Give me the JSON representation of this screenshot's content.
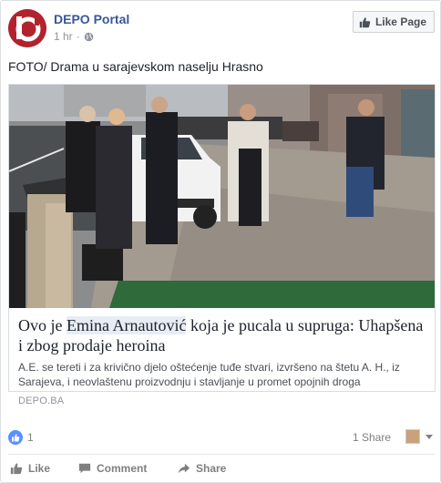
{
  "post": {
    "page_name": "DEPO Portal",
    "time": "1 hr",
    "meta_separator": "·",
    "text": "FOTO/ Drama u sarajevskom naselju Hrasno",
    "like_page_label": "Like Page"
  },
  "link": {
    "title_before": "Ovo je ",
    "title_highlight": "Emina Arnautović",
    "title_after": " koja je pucala u supruga: Uhapšena i zbog prodaje heroina",
    "description": "A.E. se tereti i za krivično djelo oštećenje tuđe stvari, izvršeno na štetu A. H., iz Sarajeva, i neovlaštenu proizvodnju i stavljanje u promet opojnih droga",
    "source": "DEPO.BA"
  },
  "reactions": {
    "count": "1",
    "shares": "1 Share"
  },
  "actions": {
    "like": "Like",
    "comment": "Comment",
    "share": "Share"
  },
  "colors": {
    "brand": "#b2232e",
    "link_blue": "#365899",
    "like_blue": "#5890ff"
  },
  "icons": [
    "globe-icon",
    "thumbs-up-icon",
    "comment-icon",
    "share-arrow-icon",
    "caret-down-icon"
  ]
}
